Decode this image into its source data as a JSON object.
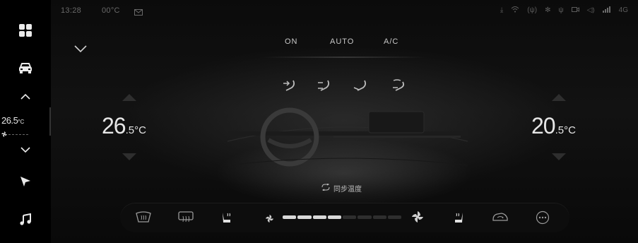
{
  "status": {
    "time": "13:28",
    "outside_temp": "00°C",
    "network": "4G",
    "icons": [
      "mail-icon",
      "download-icon",
      "wifi-icon",
      "hotspot-icon",
      "bluetooth-icon",
      "usb-icon",
      "dashcam-icon",
      "volume-icon",
      "signal-icon"
    ]
  },
  "sidebar": {
    "items": [
      "apps-grid-icon",
      "car-icon",
      "chevron-up-icon",
      "chevron-down-icon",
      "navigation-icon",
      "music-icon"
    ],
    "temp_value": "26.5",
    "temp_unit": "°C"
  },
  "climate": {
    "modes": {
      "on": "ON",
      "auto": "AUTO",
      "ac": "A/C"
    },
    "left_temp": {
      "value": "26",
      "decimal": ".5",
      "unit": "°C"
    },
    "right_temp": {
      "value": "20",
      "decimal": ".5",
      "unit": "°C"
    },
    "airflow_modes": [
      "face-airflow-icon",
      "face-feet-airflow-icon",
      "feet-airflow-icon",
      "feet-windshield-airflow-icon"
    ],
    "sync_label": "同步温度",
    "fan_level": 0.5,
    "fan_segments": 8,
    "fan_segments_on": 4
  },
  "bottom_bar": {
    "items": [
      "front-defrost-icon",
      "rear-defrost-icon",
      "seat-heat-left-icon",
      "fan-low-icon",
      "fan-high-icon",
      "seat-heat-right-icon",
      "recirculation-icon",
      "more-icon"
    ]
  },
  "colors": {
    "background": "#050505",
    "text": "#e6e6e6",
    "muted": "#6a6a6a",
    "fan_on": "#d8d8d8",
    "fan_off": "#2e2e2e"
  }
}
